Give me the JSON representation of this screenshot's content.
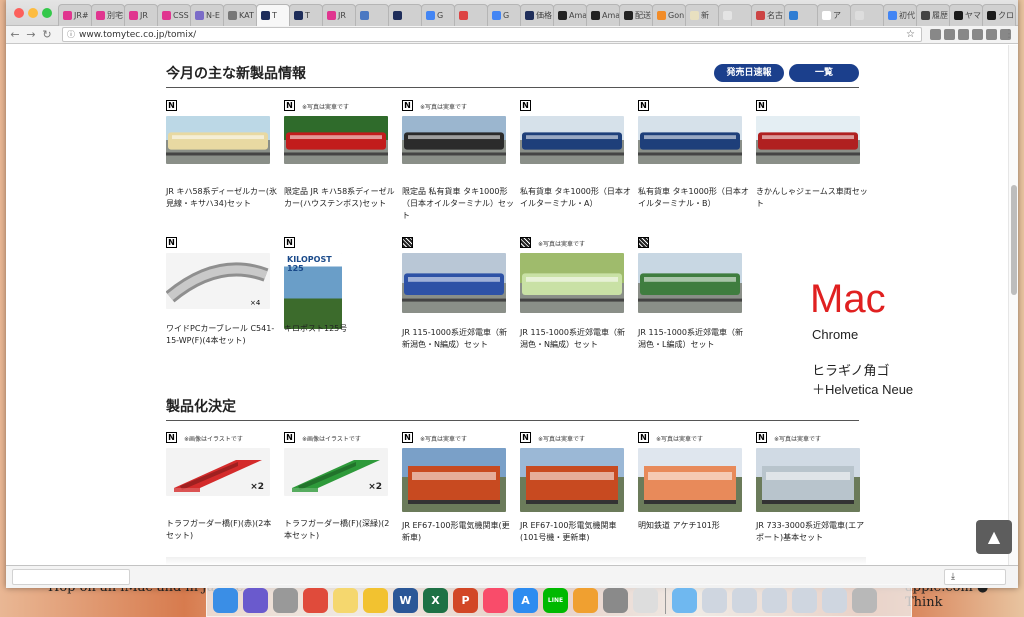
{
  "desktop": {
    "left_text": "Hop on an iMac and in just te",
    "right_text": "apple.com ● Think"
  },
  "browser": {
    "traffic_colors": [
      "#fc605c",
      "#fdbc40",
      "#34c84a"
    ],
    "tabs": [
      {
        "label": "JR#",
        "color": "#e0358f"
      },
      {
        "label": "別宅",
        "color": "#e0358f"
      },
      {
        "label": "JR",
        "color": "#e0358f"
      },
      {
        "label": "CSS",
        "color": "#e0358f"
      },
      {
        "label": "N-E",
        "color": "#7b6cc8"
      },
      {
        "label": "KAT",
        "color": "#777777"
      },
      {
        "label": "T",
        "color": "#1e2d5a",
        "active": true
      },
      {
        "label": "T",
        "color": "#1e2d5a"
      },
      {
        "label": "JR",
        "color": "#e0358f"
      },
      {
        "label": "",
        "color": "#4a78c2"
      },
      {
        "label": "",
        "color": "#1e2d5a"
      },
      {
        "label": "G",
        "color": "#4285f4"
      },
      {
        "label": "",
        "color": "#d44"
      },
      {
        "label": "G",
        "color": "#4285f4"
      },
      {
        "label": "価格",
        "color": "#1e2d5a"
      },
      {
        "label": "Ama",
        "color": "#222222"
      },
      {
        "label": "Ama",
        "color": "#222222"
      },
      {
        "label": "配送",
        "color": "#222222"
      },
      {
        "label": "Gon",
        "color": "#f28c28"
      },
      {
        "label": "新",
        "color": "#e8e0c0"
      },
      {
        "label": "",
        "color": "#e4e4e4"
      },
      {
        "label": "名古",
        "color": "#cc4444"
      },
      {
        "label": "",
        "color": "#2f7dd3"
      },
      {
        "label": "ア",
        "color": "#ffffff"
      },
      {
        "label": "",
        "color": "#dddddd"
      },
      {
        "label": "初代",
        "color": "#4285f4"
      },
      {
        "label": "履歴",
        "color": "#444444"
      },
      {
        "label": "ヤマ",
        "color": "#1b1b1b"
      },
      {
        "label": "クロ",
        "color": "#1b1b1b"
      }
    ],
    "back": "←",
    "forward": "→",
    "reload": "↻",
    "url": "www.tomytec.co.jp/tomix/",
    "star": "☆",
    "extensions": [
      "ext-1",
      "ext-2",
      "ext-3",
      "ext-4",
      "ext-5",
      "ext-6"
    ],
    "menu": "⋮"
  },
  "page": {
    "sections": [
      {
        "title": "今月の主な新製品情報",
        "buttons": [
          "発売日速報",
          "一覧"
        ]
      },
      {
        "title": "製品化決定"
      }
    ],
    "new_products": [
      {
        "badge": "N",
        "note": "",
        "title": "JR キハ58系ディーゼルカー(氷見線・キサハ34)セット"
      },
      {
        "badge": "N",
        "note": "※写真は実車です",
        "title": "限定品 JR キハ58系ディーゼルカー(ハウステンボス)セット"
      },
      {
        "badge": "N",
        "note": "※写真は実車です",
        "title": "限定品 私有貨車 タキ1000形（日本オイルターミナル）セット"
      },
      {
        "badge": "N",
        "note": "",
        "title": "私有貨車 タキ1000形（日本オイルターミナル・A）"
      },
      {
        "badge": "N",
        "note": "",
        "title": "私有貨車 タキ1000形（日本オイルターミナル・B）"
      },
      {
        "badge": "N",
        "note": "",
        "title": "きかんしゃジェームス車両セット"
      },
      {
        "badge": "N",
        "note": "",
        "title": "ワイドPCカーブレール C541-15-WP(F)(4本セット)"
      },
      {
        "badge": "N",
        "note": "",
        "title": "キロポスト125号",
        "thumb_text": "KILOPOST 125"
      },
      {
        "badge": "QR",
        "note": "",
        "title": "JR 115-1000系近郊電車（新新潟色・N編成）セット"
      },
      {
        "badge": "QR",
        "note": "※写真は実車です",
        "title": "JR 115-1000系近郊電車（新潟色・N編成）セット"
      },
      {
        "badge": "QR",
        "note": "",
        "title": "JR 115-1000系近郊電車（新潟色・L編成）セット"
      }
    ],
    "decided_products": [
      {
        "badge": "N",
        "note": "※画像はイラストです",
        "title": "トラフガーダー橋(F)(赤)(2本セット)",
        "qty": "×2"
      },
      {
        "badge": "N",
        "note": "※画像はイラストです",
        "title": "トラフガーダー橋(F)(深緑)(2本セット)",
        "qty": "×2"
      },
      {
        "badge": "N",
        "note": "※写真は実車です",
        "title": "JR EF67-100形電気機関車(更新車)"
      },
      {
        "badge": "N",
        "note": "※写真は実車です",
        "title": "JR EF67-100形電気機関車(101号機・更新車)"
      },
      {
        "badge": "N",
        "note": "※写真は実車です",
        "title": "明知鉄道 アケチ101形"
      },
      {
        "badge": "N",
        "note": "※写真は実車です",
        "title": "JR 733-3000系近郊電車(エアポート)基本セット"
      }
    ],
    "watermark": {
      "mac": "Mac",
      "browser": "Chrome",
      "font1": "ヒラギノ角ゴ",
      "font2": "＋Helvetica Neue",
      "mac_color": "#e02020"
    },
    "to_top": "▲"
  },
  "downloads": {
    "item": "",
    "icon": "⤓"
  },
  "dock": [
    {
      "name": "finder",
      "color": "#3a8ee6"
    },
    {
      "name": "siri",
      "color": "#6a5acd"
    },
    {
      "name": "launchpad",
      "color": "#999999"
    },
    {
      "name": "chrome",
      "color": "#e04b3b"
    },
    {
      "name": "notes",
      "color": "#f5d76e"
    },
    {
      "name": "duck",
      "color": "#f2c230"
    },
    {
      "name": "word",
      "color": "#2b5797",
      "glyph": "W"
    },
    {
      "name": "excel",
      "color": "#1e7145",
      "glyph": "X"
    },
    {
      "name": "powerpoint",
      "color": "#d24726",
      "glyph": "P"
    },
    {
      "name": "music",
      "color": "#f94c6a"
    },
    {
      "name": "app-store",
      "color": "#2d8cf0",
      "glyph": "A"
    },
    {
      "name": "line",
      "color": "#00b900",
      "glyph": "LINE"
    },
    {
      "name": "photos",
      "color": "#f0a030"
    },
    {
      "name": "system-preferences",
      "color": "#8a8a8a"
    },
    {
      "name": "textedit",
      "color": "#dddddd"
    },
    {
      "name": "folder",
      "color": "#6fb8f0"
    },
    {
      "name": "doc-stack-1",
      "color": "#cfd6e0"
    },
    {
      "name": "doc-stack-2",
      "color": "#cfd6e0"
    },
    {
      "name": "doc-stack-3",
      "color": "#cfd6e0"
    },
    {
      "name": "doc-stack-4",
      "color": "#cfd6e0"
    },
    {
      "name": "doc-stack-5",
      "color": "#cfd6e0"
    },
    {
      "name": "trash",
      "color": "#b8b8b8"
    }
  ]
}
